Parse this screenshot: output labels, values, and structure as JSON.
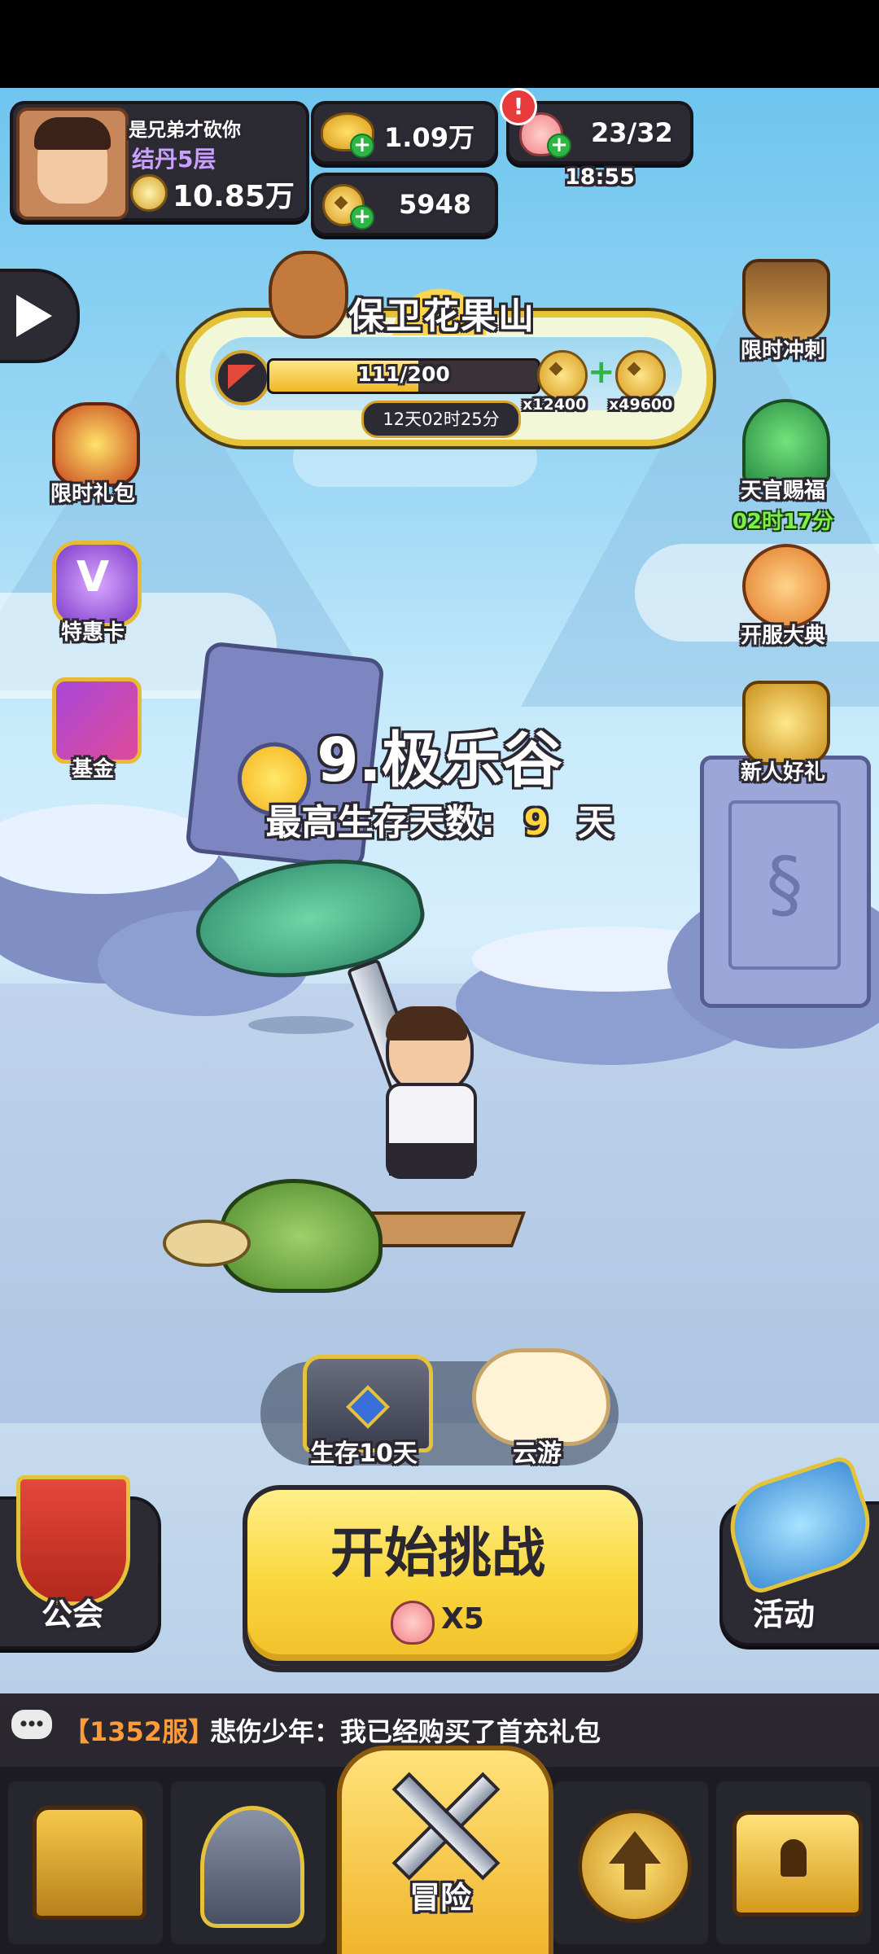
{
  "player": {
    "name": "是兄弟才砍你",
    "realm": "结丹5层",
    "power": "10.85万"
  },
  "currency": {
    "gold": "1.09万",
    "coins": "5948",
    "stamina": "23/32",
    "stamina_timer": "18:55",
    "stamina_alert": "!"
  },
  "event": {
    "title": "保卫花果山",
    "progress_text": "111/200",
    "progress_fraction": 0.555,
    "reward1": "x12400",
    "reward2": "x49600",
    "countdown": "12天02时25分"
  },
  "left_buttons": [
    {
      "label": "限时礼包"
    },
    {
      "label": "特惠卡"
    },
    {
      "label": "基金"
    }
  ],
  "right_buttons": [
    {
      "label": "限时冲刺"
    },
    {
      "label": "天官赐福",
      "timer": "02时17分"
    },
    {
      "label": "开服大典"
    },
    {
      "label": "新人好礼"
    }
  ],
  "stage": {
    "name": "9.极乐谷",
    "survival_label": "最高生存天数:",
    "survival_value": "9",
    "survival_unit": "天"
  },
  "rewards_bar": {
    "chest_label": "生存10天",
    "cloud_label": "云游"
  },
  "actions": {
    "guild": "公会",
    "start": "开始挑战",
    "cost": "X5",
    "activity": "活动"
  },
  "chat": {
    "server": "【1352服】",
    "message": "悲伤少年：我已经购买了首充礼包"
  },
  "nav": {
    "adventure": "冒险"
  },
  "colors": {
    "button_yellow": "#f9d63c",
    "realm_purple": "#c9a0ff",
    "timer_green": "#7cf04a",
    "survival_yellow": "#ffd43b",
    "server_orange": "#ff9c3a"
  }
}
